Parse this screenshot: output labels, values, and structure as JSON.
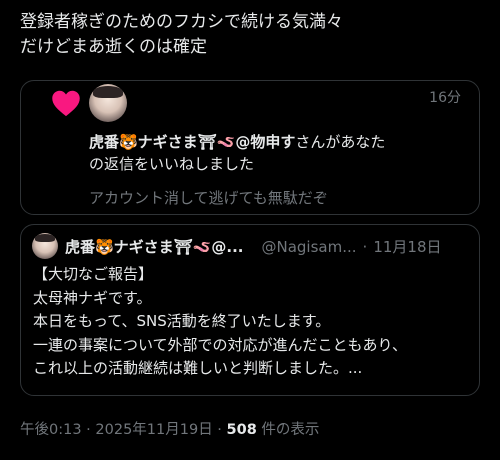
{
  "tweet": {
    "lines": [
      "登録者稼ぎのためのフカシで続ける気満々",
      "だけどまあ逝くのは確定"
    ]
  },
  "notification": {
    "icon": "heart-icon",
    "heart_color": "#f91880",
    "time": "16分",
    "actor_name": "虎番🐯ナギさま⛩🪱@物申す",
    "message_suffix": "さんがあなた",
    "message_line2": "の返信をいいねしました",
    "reply_preview": "アカウント消して逃げても無駄だぞ"
  },
  "quote": {
    "name": "虎番🐯ナギさま⛩🪱@...",
    "handle": "@Nagisam...",
    "separator": "·",
    "date": "11月18日",
    "body_lines": [
      "【大切なご報告】",
      "太母神ナギです。",
      "本日をもって、SNS活動を終了いたします。",
      "一連の事案について外部での対応が進んだこともあり、",
      "これ以上の活動継続は難しいと判断しました。..."
    ]
  },
  "meta": {
    "timestamp": "午後0:13 · 2025年11月19日 ·",
    "views_count": "508",
    "views_label": "件の表示"
  },
  "colors": {
    "background": "#000000",
    "text": "#e7e9ea",
    "muted": "#71767b",
    "border": "#2f3336"
  }
}
